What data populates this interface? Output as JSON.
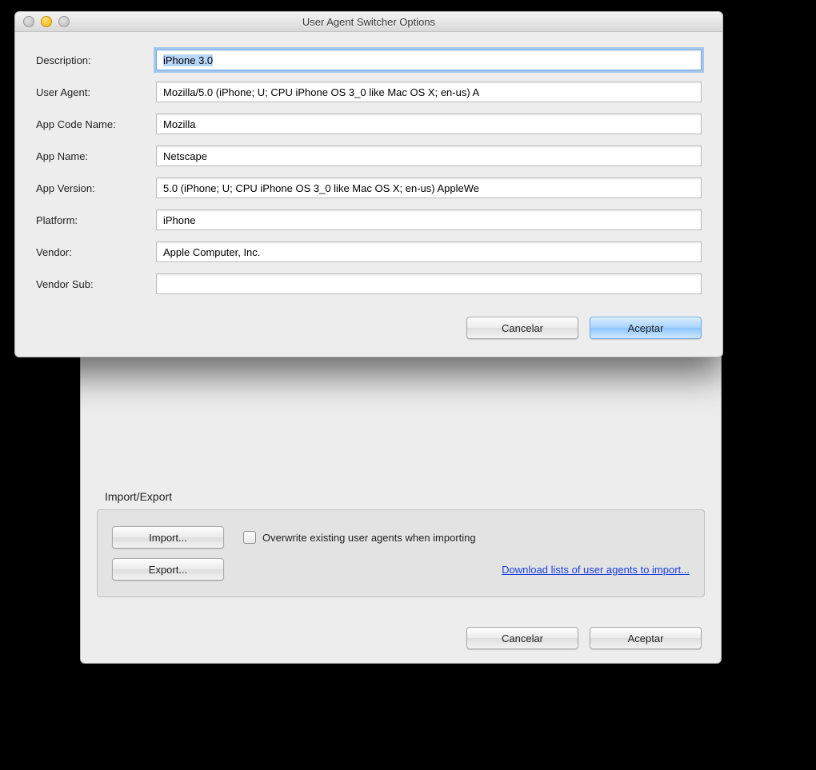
{
  "front_dialog": {
    "title": "User Agent Switcher Options",
    "fields": {
      "description": {
        "label": "Description:",
        "value": "iPhone 3.0"
      },
      "user_agent": {
        "label": "User Agent:",
        "value": "Mozilla/5.0 (iPhone; U; CPU iPhone OS 3_0 like Mac OS X; en-us) A"
      },
      "app_code_name": {
        "label": "App Code Name:",
        "value": "Mozilla"
      },
      "app_name": {
        "label": "App Name:",
        "value": "Netscape"
      },
      "app_version": {
        "label": "App Version:",
        "value": "5.0 (iPhone; U; CPU iPhone OS 3_0 like Mac OS X; en-us) AppleWe"
      },
      "platform": {
        "label": "Platform:",
        "value": "iPhone"
      },
      "vendor": {
        "label": "Vendor:",
        "value": "Apple Computer, Inc."
      },
      "vendor_sub": {
        "label": "Vendor Sub:",
        "value": ""
      }
    },
    "buttons": {
      "cancel": "Cancelar",
      "accept": "Aceptar"
    }
  },
  "back_window": {
    "section_title": "Import/Export",
    "import_label": "Import...",
    "export_label": "Export...",
    "overwrite_label": "Overwrite existing user agents when importing",
    "overwrite_checked": false,
    "download_link": "Download lists of user agents to import...",
    "buttons": {
      "cancel": "Cancelar",
      "accept": "Aceptar"
    }
  }
}
